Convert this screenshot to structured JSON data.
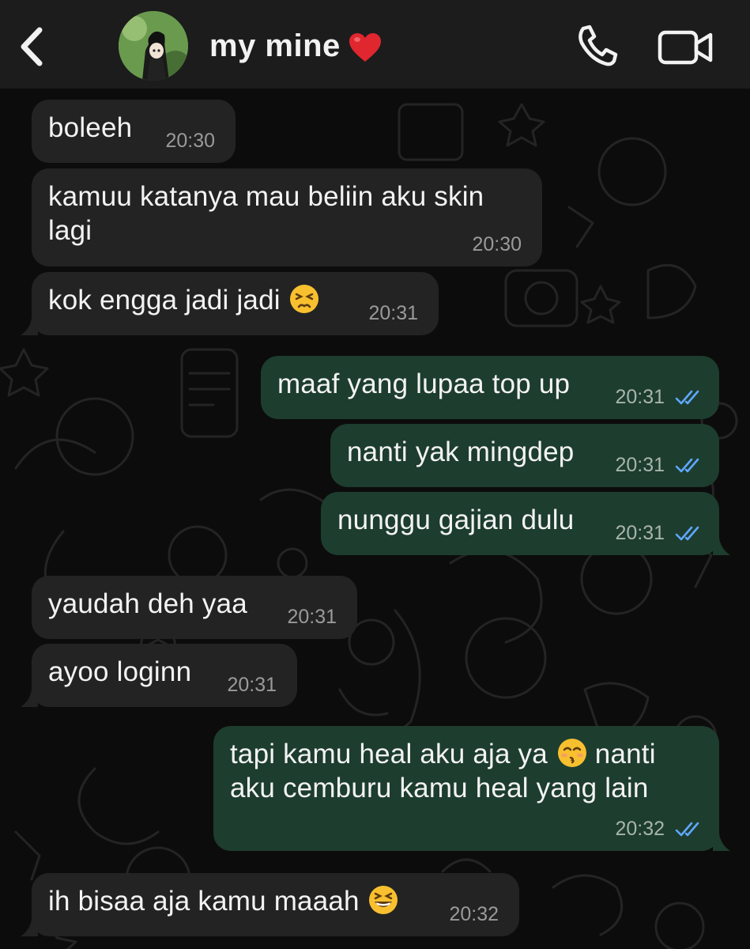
{
  "header": {
    "contact_name": "my mine",
    "back_icon": "chevron-left-icon",
    "heart_icon": "red-heart-icon",
    "call_icon": "phone-icon",
    "video_icon": "video-camera-icon"
  },
  "colors": {
    "header_bg": "#1c1c1c",
    "chat_bg": "#0c0c0c",
    "incoming_bubble": "#232323",
    "outgoing_bubble": "#1d3d2e",
    "read_ticks": "#5fa8ff",
    "heart": "#e0262f"
  },
  "messages": [
    {
      "direction": "in",
      "text": "boleeh",
      "time": "20:30"
    },
    {
      "direction": "in",
      "text": "kamuu katanya mau beliin aku skin lagi",
      "time": "20:30"
    },
    {
      "direction": "in",
      "text": "kok engga jadi jadi",
      "emoji": "persevering-face-emoji",
      "time": "20:31"
    },
    {
      "direction": "out",
      "text": "maaf yang lupaa top up",
      "time": "20:31",
      "status": "read"
    },
    {
      "direction": "out",
      "text": "nanti yak mingdep",
      "time": "20:31",
      "status": "read"
    },
    {
      "direction": "out",
      "text": "nunggu gajian dulu",
      "time": "20:31",
      "status": "read"
    },
    {
      "direction": "in",
      "text": "yaudah deh yaa",
      "time": "20:31"
    },
    {
      "direction": "in",
      "text": "ayoo loginn",
      "time": "20:31"
    },
    {
      "direction": "out",
      "text_before_emoji": "tapi kamu heal aku aja ya",
      "emoji": "kissing-closed-eyes-emoji",
      "text_after_emoji": "nanti aku cemburu kamu heal yang lain",
      "time": "20:32",
      "status": "read"
    },
    {
      "direction": "in",
      "text": "ih bisaa aja kamu maaah",
      "emoji": "grinning-squinting-face-emoji",
      "time": "20:32"
    }
  ]
}
